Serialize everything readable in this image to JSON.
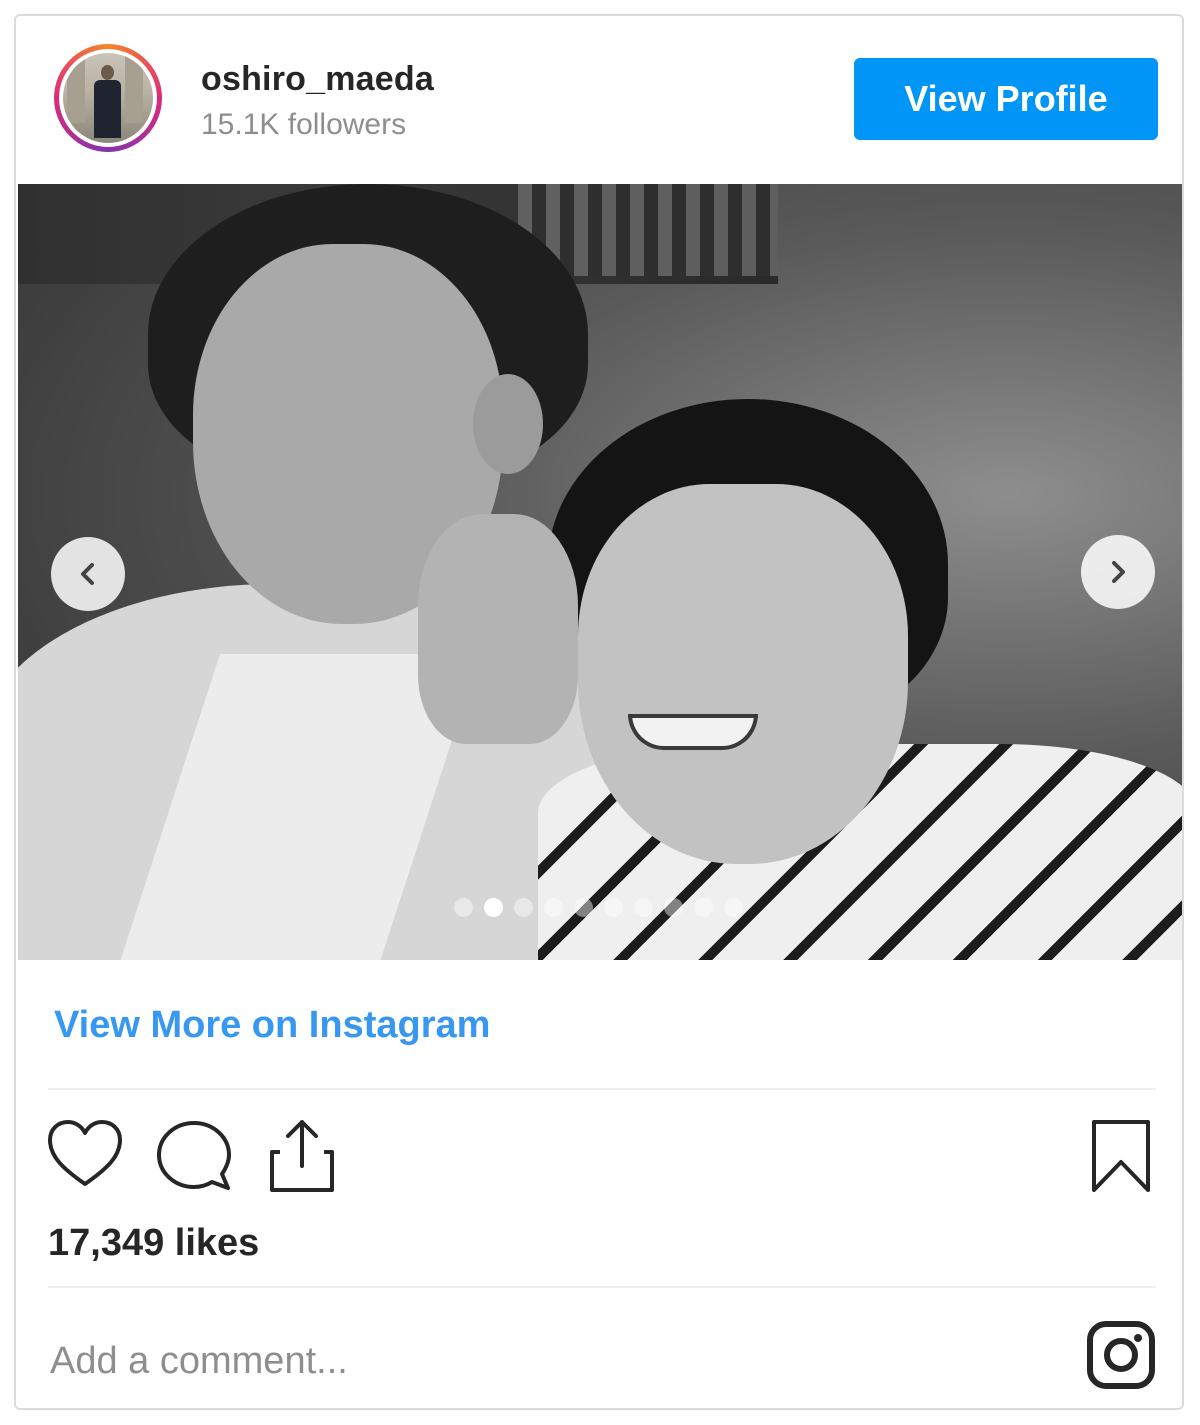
{
  "header": {
    "username": "oshiro_maeda",
    "followers": "15.1K followers",
    "view_profile_label": "View Profile"
  },
  "post": {
    "carousel": {
      "total_slides": 10,
      "active_slide": 2
    },
    "view_more_label": "View More on Instagram",
    "likes": "17,349 likes"
  },
  "comment": {
    "placeholder": "Add a comment..."
  },
  "colors": {
    "accent": "#0095f6",
    "link": "#3897f0",
    "text": "#262626",
    "muted": "#8e8e8e"
  },
  "icons": {
    "like": "heart-icon",
    "comment": "comment-icon",
    "share": "share-icon",
    "save": "bookmark-icon",
    "brand": "instagram-icon",
    "prev": "chevron-left-icon",
    "next": "chevron-right-icon"
  }
}
